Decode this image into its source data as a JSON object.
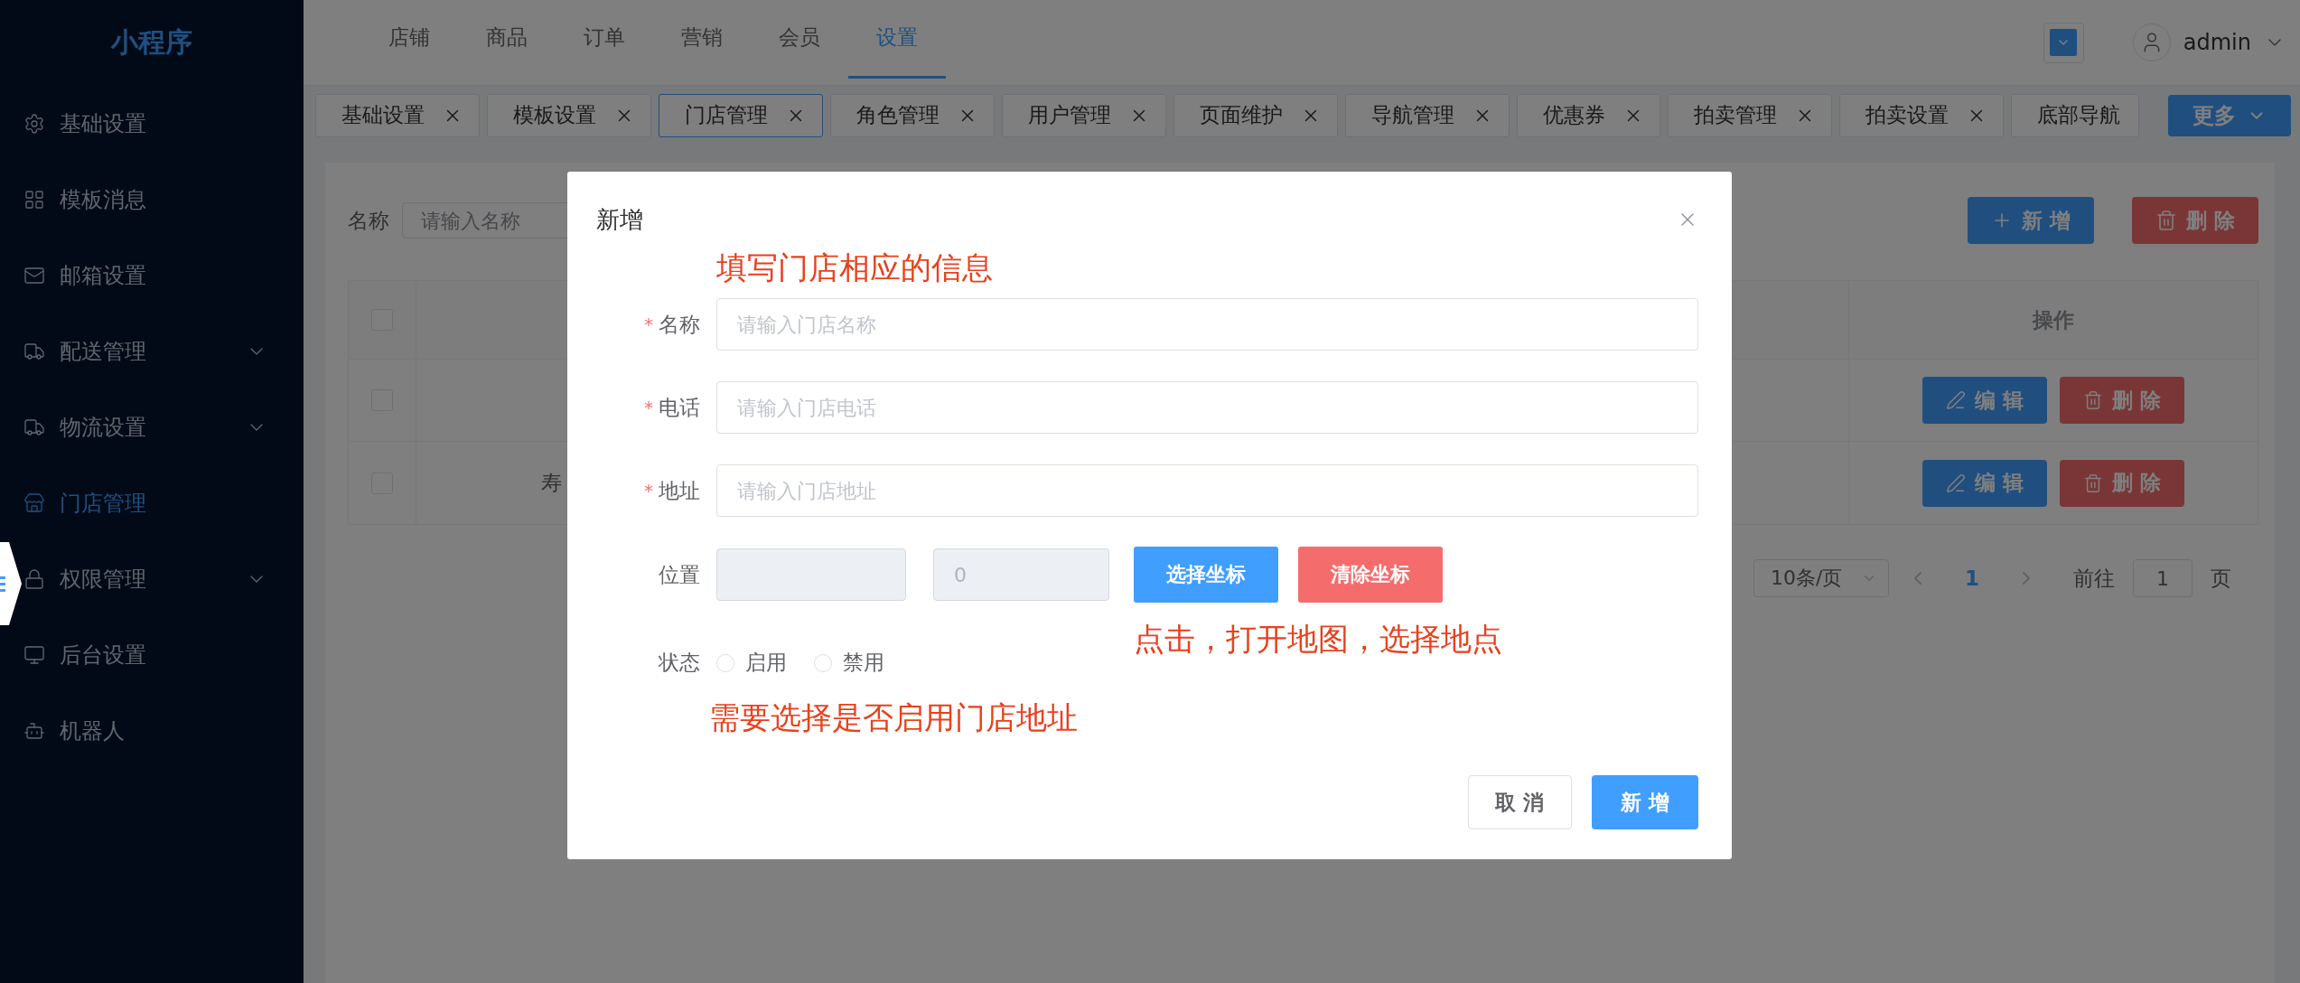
{
  "sidebar": {
    "logo": "小程序",
    "items": [
      {
        "label": "基础设置",
        "kind": "item",
        "selected": false
      },
      {
        "label": "模板消息",
        "kind": "item",
        "selected": false
      },
      {
        "label": "邮箱设置",
        "kind": "item",
        "selected": false
      },
      {
        "label": "配送管理",
        "kind": "submenu",
        "selected": false,
        "expanded": false
      },
      {
        "label": "物流设置",
        "kind": "submenu",
        "selected": false,
        "expanded": false
      },
      {
        "label": "门店管理",
        "kind": "item",
        "selected": true
      },
      {
        "label": "权限管理",
        "kind": "submenu",
        "selected": false,
        "expanded": false
      },
      {
        "label": "后台设置",
        "kind": "item",
        "selected": false
      },
      {
        "label": "机器人",
        "kind": "item",
        "selected": false
      }
    ]
  },
  "top_nav": {
    "items": [
      {
        "label": "店铺",
        "selected": false
      },
      {
        "label": "商品",
        "selected": false
      },
      {
        "label": "订单",
        "selected": false
      },
      {
        "label": "营销",
        "selected": false
      },
      {
        "label": "会员",
        "selected": false
      },
      {
        "label": "设置",
        "selected": true
      }
    ],
    "user": "admin"
  },
  "tabs": {
    "items": [
      {
        "label": "基础设置",
        "selected": false,
        "closable": true
      },
      {
        "label": "模板设置",
        "selected": false,
        "closable": true
      },
      {
        "label": "门店管理",
        "selected": true,
        "closable": true
      },
      {
        "label": "角色管理",
        "selected": false,
        "closable": true
      },
      {
        "label": "用户管理",
        "selected": false,
        "closable": true
      },
      {
        "label": "页面维护",
        "selected": false,
        "closable": true
      },
      {
        "label": "导航管理",
        "selected": false,
        "closable": true
      },
      {
        "label": "优惠券",
        "selected": false,
        "closable": true
      },
      {
        "label": "拍卖管理",
        "selected": false,
        "closable": true
      },
      {
        "label": "拍卖设置",
        "selected": false,
        "closable": true
      },
      {
        "label": "底部导航",
        "selected": false,
        "closable": false
      }
    ],
    "more": "更多"
  },
  "filter": {
    "label": "名称",
    "placeholder": "请输入名称"
  },
  "toolbar": {
    "add": "新 增",
    "delete": "删 除"
  },
  "table": {
    "header": {
      "checked": false,
      "actions_title": "操作"
    },
    "rows": [
      {
        "checked": false,
        "actions": [
          "编 辑",
          "删 除"
        ]
      },
      {
        "checked": false,
        "column_2": "寿",
        "actions": [
          "编 辑",
          "删 除"
        ]
      }
    ]
  },
  "pagination": {
    "page_size": "10条/页",
    "pages": [
      {
        "label": "1",
        "selected": true
      }
    ],
    "goto_label": "前往",
    "goto_value": "1",
    "goto_suffix": "页"
  },
  "modal": {
    "title": "新增",
    "hint_top": "填写门店相应的信息",
    "required_mark": "*",
    "fields": [
      {
        "label": "名称",
        "required": true,
        "placeholder": "请输入门店名称"
      },
      {
        "label": "电话",
        "required": true,
        "placeholder": "请输入门店电话"
      },
      {
        "label": "地址",
        "required": true,
        "placeholder": "请输入门店地址"
      }
    ],
    "position": {
      "label": "位置",
      "inputs": [
        {
          "disabled": true
        },
        {
          "value": "0",
          "disabled": true
        }
      ],
      "buttons": [
        {
          "label": "选择坐标",
          "kind": "primary"
        },
        {
          "label": "清除坐标",
          "kind": "danger"
        }
      ]
    },
    "hint_map": "点击，打开地图，选择地点",
    "status": {
      "label": "状态",
      "options": [
        {
          "label": "启用",
          "selected": false
        },
        {
          "label": "禁用",
          "selected": false
        }
      ]
    },
    "hint_status": "需要选择是否启用门店地址",
    "footer": [
      {
        "label": "取 消",
        "kind": "default"
      },
      {
        "label": "新 增",
        "kind": "primary"
      }
    ]
  }
}
